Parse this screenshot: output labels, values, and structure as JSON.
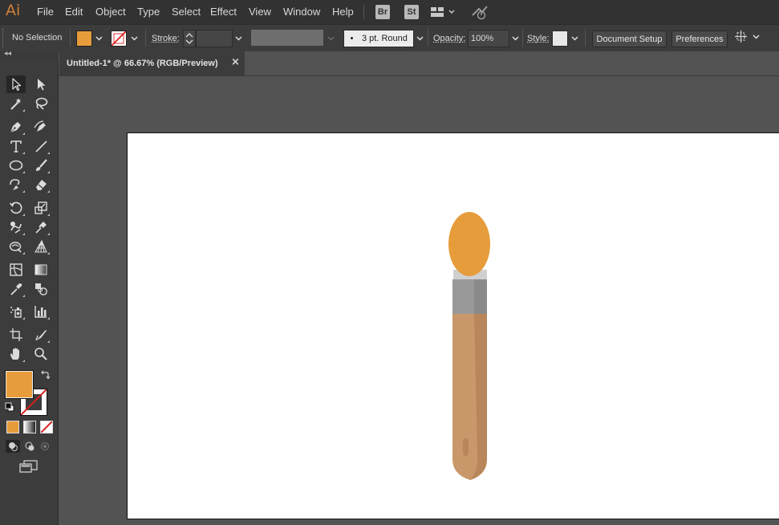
{
  "app": {
    "logo": "Ai",
    "menu": [
      "File",
      "Edit",
      "Object",
      "Type",
      "Select",
      "Effect",
      "View",
      "Window",
      "Help"
    ],
    "bridge_badge": "Br",
    "stock_badge": "St"
  },
  "control_bar": {
    "selection_status": "No Selection",
    "fill_color": "#e79c3c",
    "stroke_label": "Stroke:",
    "brush_label": "3 pt. Round",
    "opacity_label": "Opacity:",
    "opacity_value": "100%",
    "style_label": "Style:",
    "document_setup": "Document Setup",
    "preferences": "Preferences"
  },
  "document": {
    "tab_title": "Untitled-1* @ 66.67% (RGB/Preview)",
    "close_glyph": "×"
  },
  "toolbox": {
    "collapse_glyph": "◂◂",
    "fill_color": "#e79c3c",
    "stroke_color": "none"
  },
  "artwork": {
    "tip_color": "#e79c3c",
    "ferrule_color": "#999999",
    "ferrule_shade": "#8a8a8a",
    "ferrule_highlight": "#cfcfcf",
    "handle_color": "#c8976a",
    "handle_shade": "#b8865a"
  },
  "icons": {
    "selection": "selection-arrow-icon",
    "direct_selection": "direct-selection-icon",
    "magic_wand": "magic-wand-icon",
    "lasso": "lasso-icon",
    "pen": "pen-icon",
    "curvature": "curvature-icon",
    "type": "type-icon",
    "line": "line-segment-icon",
    "ellipse": "ellipse-icon",
    "paintbrush": "paintbrush-icon",
    "shaper": "shaper-icon",
    "eraser": "eraser-icon",
    "rotate": "rotate-icon",
    "scale": "scale-icon",
    "warp": "warp-icon",
    "puppet_warp": "puppet-warp-icon",
    "free_transform": "free-transform-icon",
    "perspective": "perspective-grid-icon",
    "mesh": "mesh-icon",
    "gradient": "gradient-icon",
    "eyedropper": "eyedropper-icon",
    "blend": "blend-icon",
    "symbol_sprayer": "symbol-sprayer-icon",
    "graph": "column-graph-icon",
    "artboard": "artboard-icon",
    "slice": "slice-icon",
    "hand": "hand-icon",
    "zoom": "zoom-icon"
  }
}
